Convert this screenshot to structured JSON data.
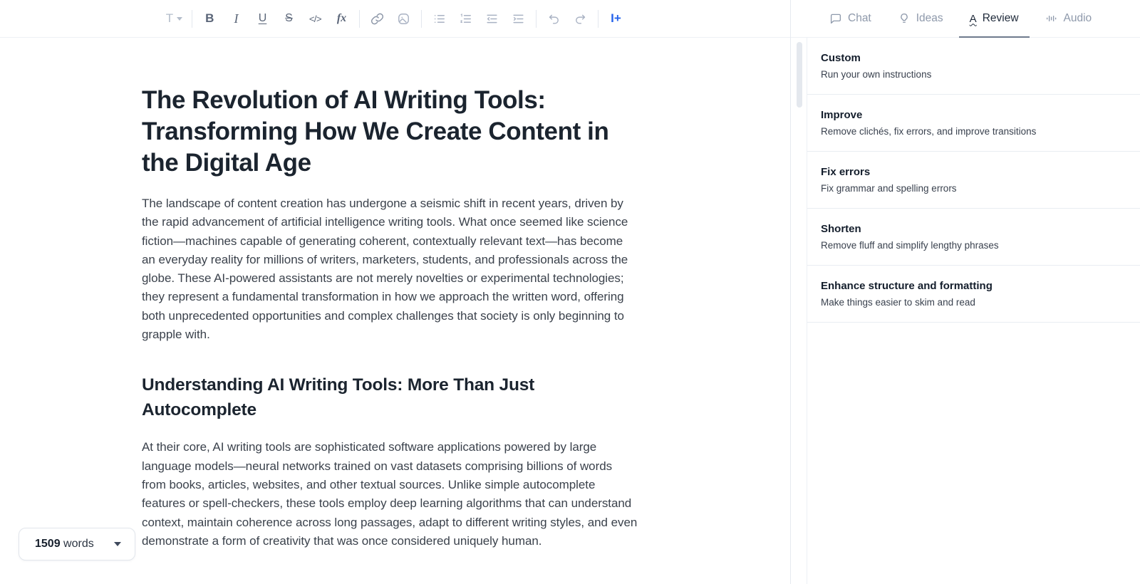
{
  "toolbar": {
    "text_style_label": "T",
    "bold_label": "B",
    "italic_label": "I",
    "underline_label": "U",
    "strikethrough_label": "S",
    "code_label": "</>",
    "formula_label": "fx",
    "ai_label": "I+"
  },
  "sidebar": {
    "tabs": [
      {
        "label": "Chat",
        "active": false
      },
      {
        "label": "Ideas",
        "active": false
      },
      {
        "label": "Review",
        "active": true
      },
      {
        "label": "Audio",
        "active": false
      }
    ],
    "review_items": [
      {
        "title": "Custom",
        "subtitle": "Run your own instructions"
      },
      {
        "title": "Improve",
        "subtitle": "Remove clichés, fix errors, and improve transitions"
      },
      {
        "title": "Fix errors",
        "subtitle": "Fix grammar and spelling errors"
      },
      {
        "title": "Shorten",
        "subtitle": "Remove fluff and simplify lengthy phrases"
      },
      {
        "title": "Enhance structure and formatting",
        "subtitle": "Make things easier to skim and read"
      }
    ]
  },
  "document": {
    "title": "The Revolution of AI Writing Tools: Transforming How We Create Content in the Digital Age",
    "paragraph_1": "The landscape of content creation has undergone a seismic shift in recent years, driven by the rapid advancement of artificial intelligence writing tools. What once seemed like science fiction—machines capable of generating coherent, contextually relevant text—has become an everyday reality for millions of writers, marketers, students, and professionals across the globe. These AI-powered assistants are not merely novelties or experimental technologies; they represent a fundamental transformation in how we approach the written word, offering both unprecedented opportunities and complex challenges that society is only beginning to grapple with.",
    "heading_2": "Understanding AI Writing Tools: More Than Just Autocomplete",
    "paragraph_2": "At their core, AI writing tools are sophisticated software applications powered by large language models—neural networks trained on vast datasets comprising billions of words from books, articles, websites, and other textual sources. Unlike simple autocomplete features or spell-checkers, these tools employ deep learning algorithms that can understand context, maintain coherence across long passages, adapt to different writing styles, and even demonstrate a form of creativity that was once considered uniquely human."
  },
  "word_count": {
    "count": "1509",
    "unit": "words"
  },
  "colors": {
    "accent_blue": "#2563eb",
    "active_tab_text": "#1f2a3a",
    "inactive_tab_text": "#8e99ab"
  }
}
